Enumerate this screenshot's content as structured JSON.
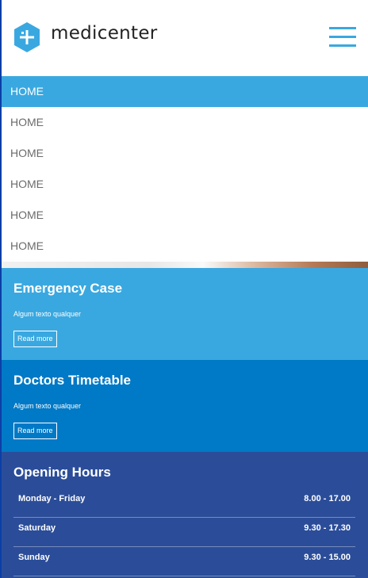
{
  "header": {
    "brand": "medicenter",
    "logo_icon": "medical-cross-hexagon-icon",
    "menu_icon": "hamburger-menu-icon",
    "accent": "#3aa8e0"
  },
  "menu": {
    "items": [
      {
        "label": "HOME",
        "active": true
      },
      {
        "label": "HOME",
        "active": false
      },
      {
        "label": "HOME",
        "active": false
      },
      {
        "label": "HOME",
        "active": false
      },
      {
        "label": "HOME",
        "active": false
      },
      {
        "label": "HOME",
        "active": false
      }
    ]
  },
  "emergency": {
    "title": "Emergency Case",
    "text": "Algum texto qualquer",
    "button": "Read more",
    "color": "#3aa8e0"
  },
  "doctors": {
    "title": "Doctors Timetable",
    "text": "Algum texto qualquer",
    "button": "Read more",
    "color": "#0079c6"
  },
  "hours": {
    "title": "Opening Hours",
    "color": "#2b4d99",
    "rows": [
      {
        "day": "Monday - Friday",
        "time": "8.00 - 17.00"
      },
      {
        "day": "Saturday",
        "time": "9.30 - 17.30"
      },
      {
        "day": "Sunday",
        "time": "9.30 - 15.00"
      }
    ]
  }
}
